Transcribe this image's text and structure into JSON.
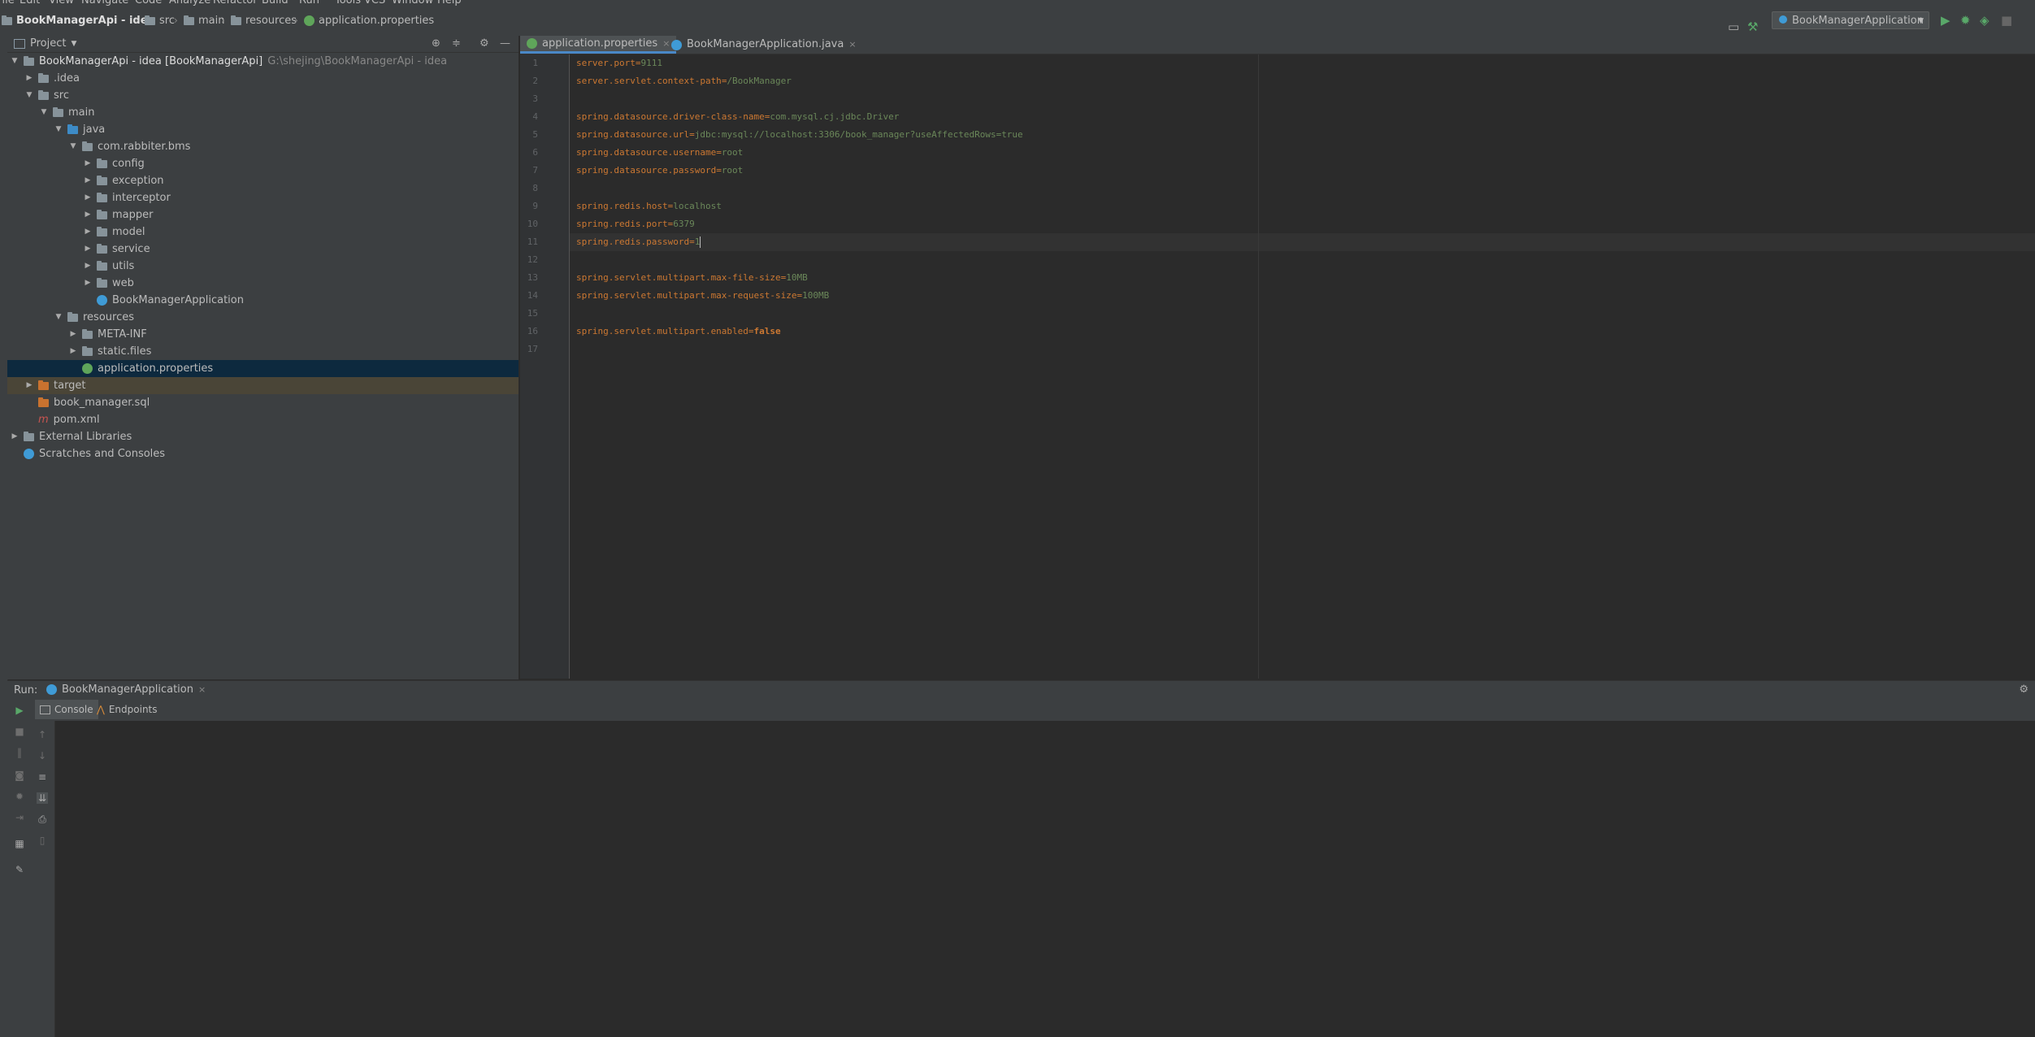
{
  "menu": [
    "File",
    "Edit",
    "View",
    "Navigate",
    "Code",
    "Analyze",
    "Refactor",
    "Build",
    "Run",
    "Tools",
    "VCS",
    "Window",
    "Help"
  ],
  "breadcrumbs": {
    "project": "BookManagerApi - idea",
    "items": [
      "src",
      "main",
      "resources",
      "application.properties"
    ]
  },
  "run_config": {
    "label": "BookManagerApplication"
  },
  "project_panel": {
    "title": "Project",
    "tree": [
      {
        "label": "BookManagerApi - idea [BookManagerApi]",
        "extra": "G:\\shejing\\BookManagerApi - idea",
        "level": 0,
        "arrow": "▼",
        "icon": "folder"
      },
      {
        "label": ".idea",
        "level": 1,
        "arrow": "▶",
        "icon": "folder"
      },
      {
        "label": "src",
        "level": 1,
        "arrow": "▼",
        "icon": "folder"
      },
      {
        "label": "main",
        "level": 2,
        "arrow": "▼",
        "icon": "folder"
      },
      {
        "label": "java",
        "level": 3,
        "arrow": "▼",
        "icon": "folder-blue"
      },
      {
        "label": "com.rabbiter.bms",
        "level": 4,
        "arrow": "▼",
        "icon": "package"
      },
      {
        "label": "config",
        "level": 5,
        "arrow": "▶",
        "icon": "package"
      },
      {
        "label": "exception",
        "level": 5,
        "arrow": "▶",
        "icon": "package"
      },
      {
        "label": "interceptor",
        "level": 5,
        "arrow": "▶",
        "icon": "package"
      },
      {
        "label": "mapper",
        "level": 5,
        "arrow": "▶",
        "icon": "package"
      },
      {
        "label": "model",
        "level": 5,
        "arrow": "▶",
        "icon": "package"
      },
      {
        "label": "service",
        "level": 5,
        "arrow": "▶",
        "icon": "package"
      },
      {
        "label": "utils",
        "level": 5,
        "arrow": "▶",
        "icon": "package"
      },
      {
        "label": "web",
        "level": 5,
        "arrow": "▶",
        "icon": "package"
      },
      {
        "label": "BookManagerApplication",
        "level": 5,
        "arrow": "",
        "icon": "spring-class"
      },
      {
        "label": "resources",
        "level": 3,
        "arrow": "▼",
        "icon": "folder"
      },
      {
        "label": "META-INF",
        "level": 4,
        "arrow": "▶",
        "icon": "folder"
      },
      {
        "label": "static.files",
        "level": 4,
        "arrow": "▶",
        "icon": "folder"
      },
      {
        "label": "application.properties",
        "level": 4,
        "arrow": "",
        "icon": "spring-leaf",
        "selected": true
      },
      {
        "label": "target",
        "level": 1,
        "arrow": "▶",
        "icon": "folder-orange",
        "target": true
      },
      {
        "label": "book_manager.sql",
        "level": 1,
        "arrow": "",
        "icon": "sql-file"
      },
      {
        "label": "pom.xml",
        "level": 1,
        "arrow": "",
        "icon": "maven-file"
      },
      {
        "label": "External Libraries",
        "level": 0,
        "arrow": "▶",
        "icon": "libraries"
      },
      {
        "label": "Scratches and Consoles",
        "level": 0,
        "arrow": "",
        "icon": "scratches"
      }
    ]
  },
  "editor": {
    "tabs": [
      {
        "label": "application.properties",
        "active": true
      },
      {
        "label": "BookManagerApplication.java",
        "active": false
      }
    ],
    "current_line": 11,
    "lines": [
      {
        "n": "1",
        "key": "server.port",
        "val": "9111"
      },
      {
        "n": "2",
        "key": "server.servlet.context-path",
        "val": "/BookManager"
      },
      {
        "n": "3",
        "key": "",
        "val": ""
      },
      {
        "n": "4",
        "key": "spring.datasource.driver-class-name",
        "val": "com.mysql.cj.jdbc.Driver"
      },
      {
        "n": "5",
        "key": "spring.datasource.url",
        "val": "jdbc:mysql://localhost:3306/book_manager?useAffectedRows=true"
      },
      {
        "n": "6",
        "key": "spring.datasource.username",
        "val": "root"
      },
      {
        "n": "7",
        "key": "spring.datasource.password",
        "val": "root"
      },
      {
        "n": "8",
        "key": "",
        "val": ""
      },
      {
        "n": "9",
        "key": "spring.redis.host",
        "val": "localhost"
      },
      {
        "n": "10",
        "key": "spring.redis.port",
        "val": "6379"
      },
      {
        "n": "11",
        "key": "spring.redis.password",
        "val": "1"
      },
      {
        "n": "12",
        "key": "",
        "val": ""
      },
      {
        "n": "13",
        "key": "spring.servlet.multipart.max-file-size",
        "val": "10MB"
      },
      {
        "n": "14",
        "key": "spring.servlet.multipart.max-request-size",
        "val": "100MB"
      },
      {
        "n": "15",
        "key": "",
        "val": ""
      },
      {
        "n": "16",
        "key": "spring.servlet.multipart.enabled",
        "val": "false",
        "bold": true
      },
      {
        "n": "17",
        "key": "",
        "val": ""
      }
    ]
  },
  "run_panel": {
    "label": "Run:",
    "config_tab": "BookManagerApplication",
    "subtabs": [
      "Console",
      "Endpoints"
    ]
  },
  "colors": {
    "key": "#cc7832",
    "value": "#6a8759",
    "selection": "#0d293e",
    "accent": "#4a88c7"
  }
}
